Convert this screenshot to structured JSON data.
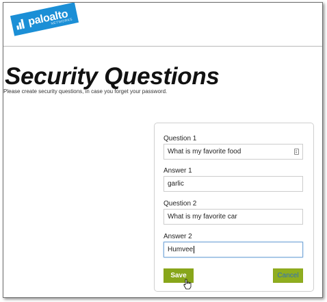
{
  "header": {
    "logo_text": "paloalto",
    "logo_subtext": "NETWORKS"
  },
  "page": {
    "title": "Security Questions",
    "subtitle": "Please create security questions, in case you forget your password."
  },
  "form": {
    "question1_label": "Question 1",
    "question1_value": "What is my favorite food",
    "answer1_label": "Answer 1",
    "answer1_value": "garlic",
    "question2_label": "Question 2",
    "question2_value": "What is my favorite car",
    "answer2_label": "Answer 2",
    "answer2_value": "Humvee",
    "save_label": "Save",
    "cancel_label": "Cancel"
  },
  "icons": {
    "logo": "paloalto-logo-icon",
    "select": "select-arrows-icon",
    "cursor": "hand-pointer-cursor-icon"
  },
  "colors": {
    "brand_blue": "#1b8fd6",
    "button_green": "#87a61a",
    "cancel_text": "#2f6fbf"
  }
}
